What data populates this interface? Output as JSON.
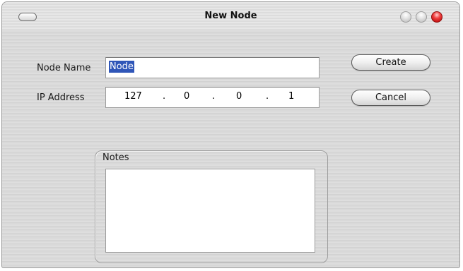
{
  "window": {
    "title": "New Node"
  },
  "form": {
    "node_name_label": "Node Name",
    "node_name_value": "Node",
    "ip_label": "IP Address",
    "ip_octets": [
      "127",
      "0",
      "0",
      "1"
    ],
    "ip_separator": "."
  },
  "buttons": {
    "create": "Create",
    "cancel": "Cancel"
  },
  "notes": {
    "label": "Notes",
    "value": ""
  },
  "colors": {
    "close_light": "#e02020",
    "selection": "#2f56b8"
  }
}
